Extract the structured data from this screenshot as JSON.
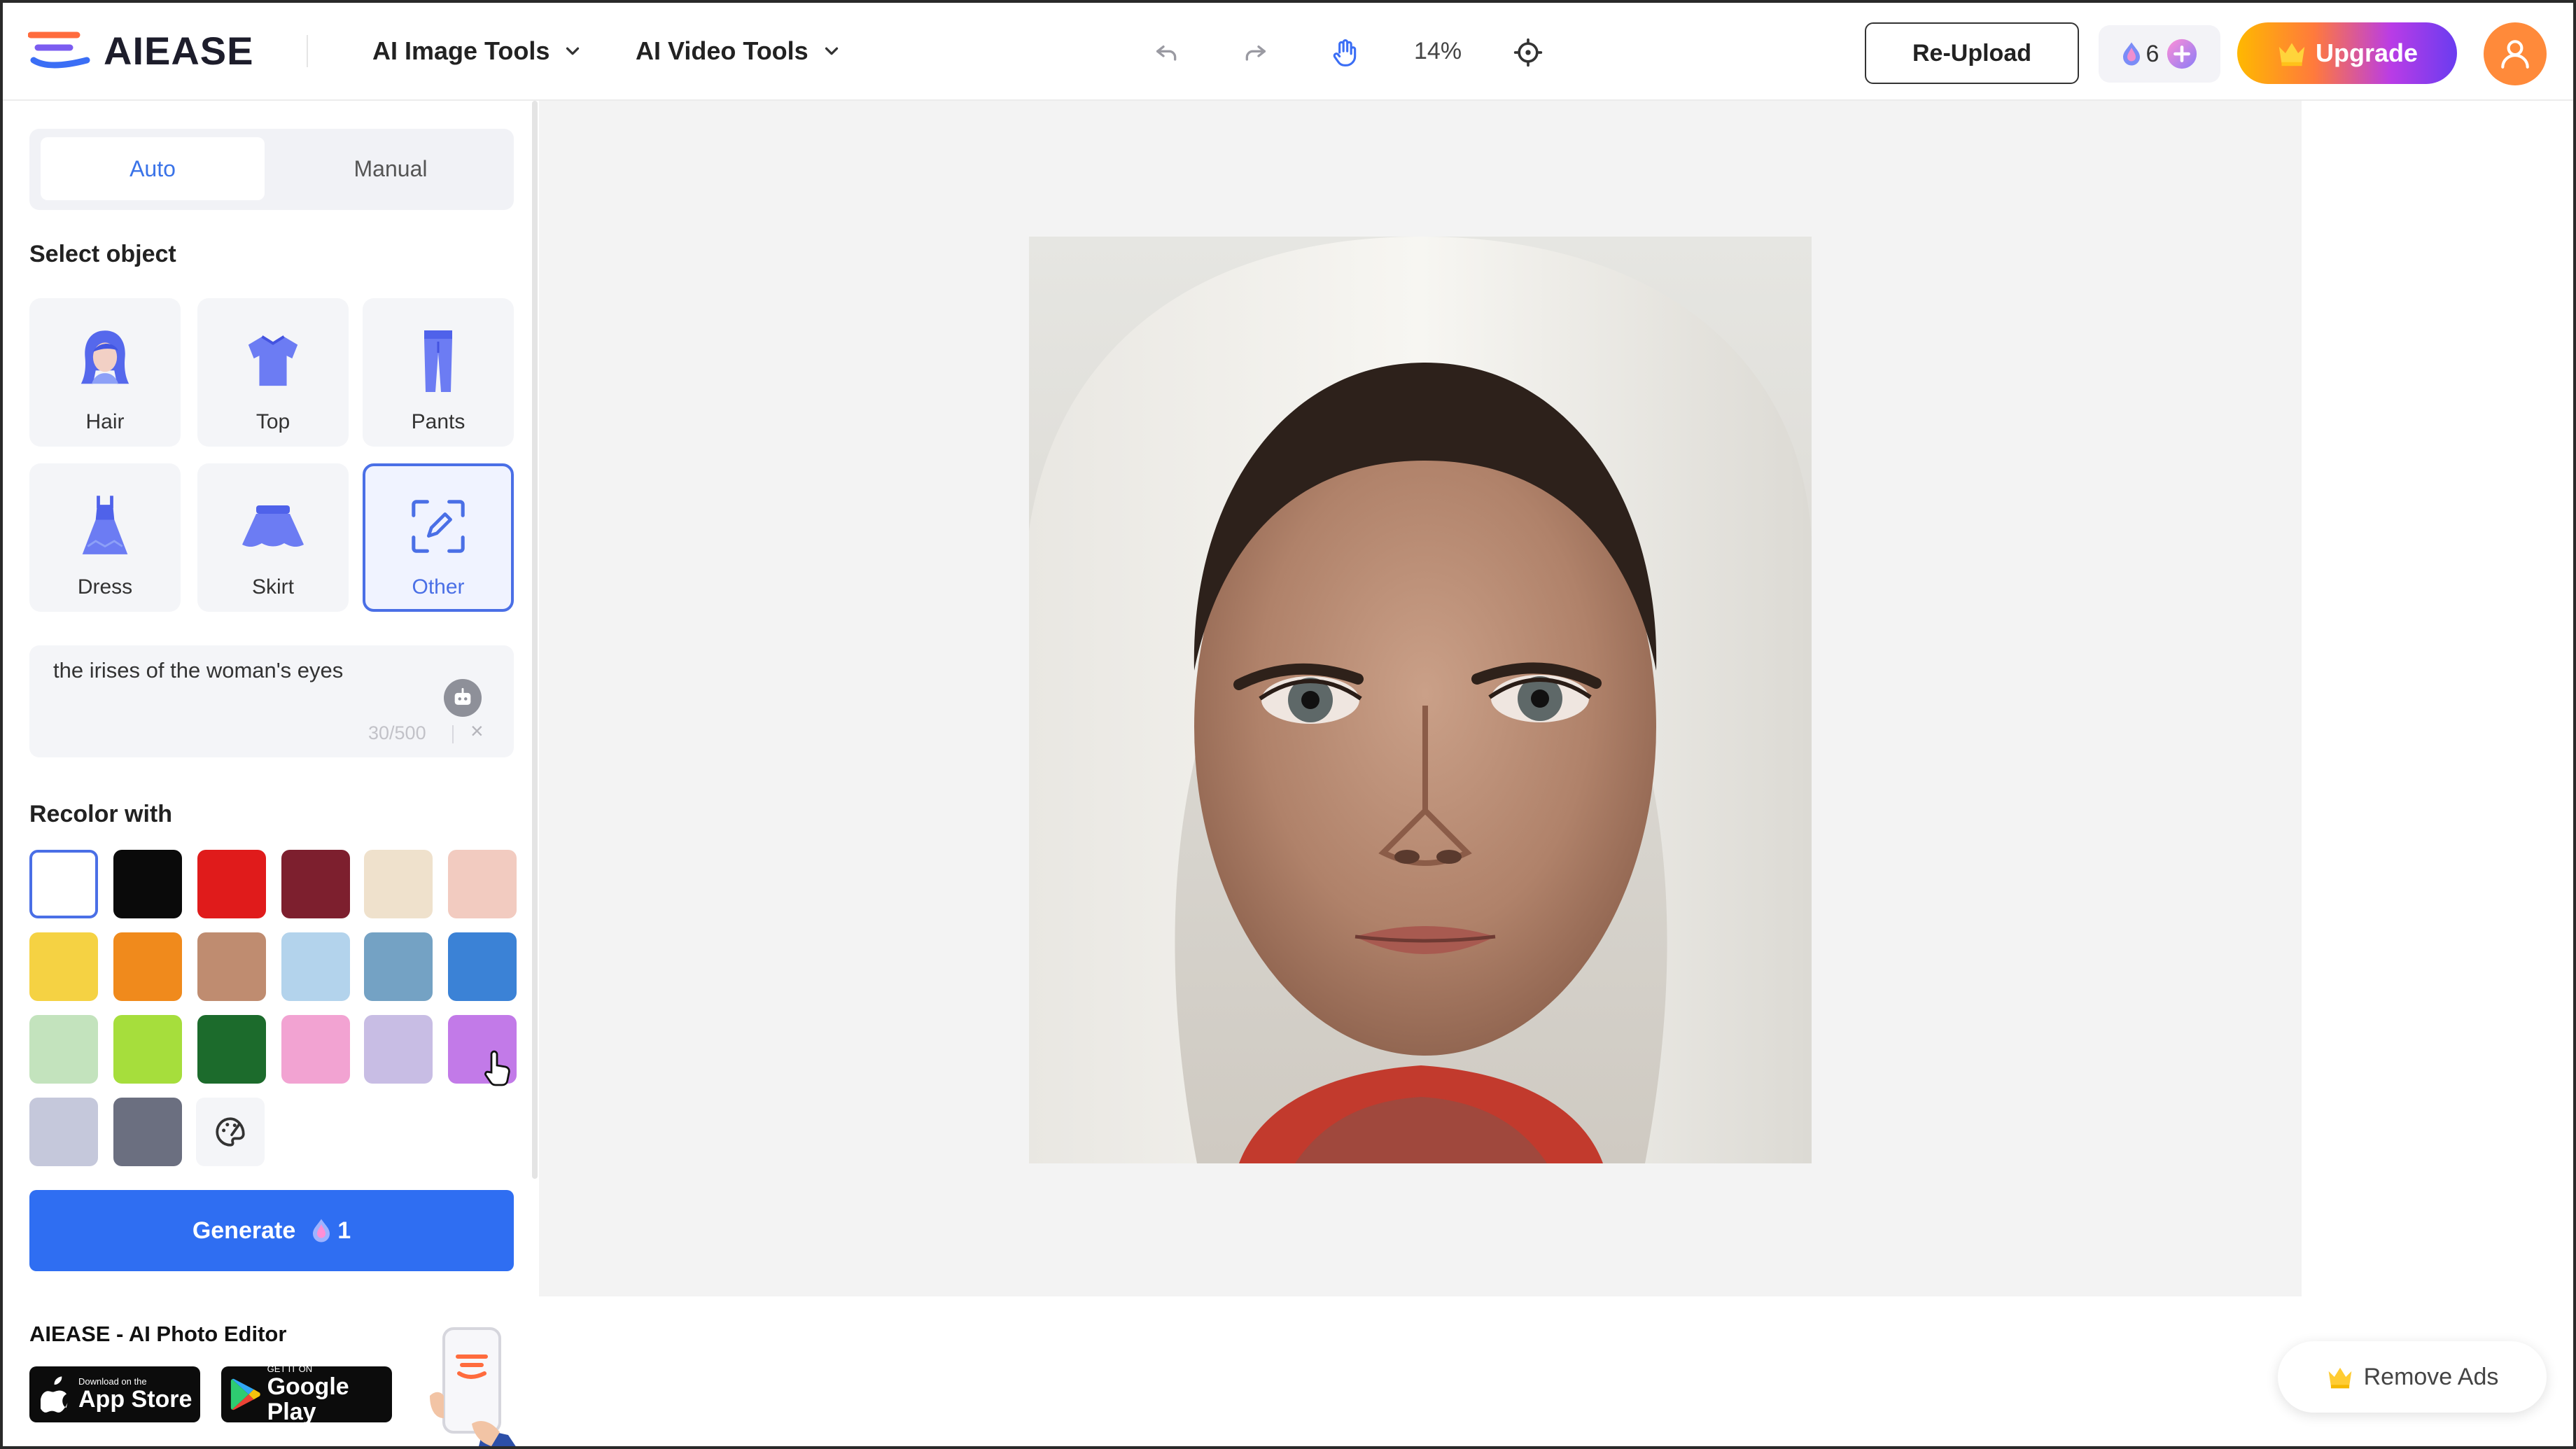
{
  "brand": {
    "name": "AIEASE"
  },
  "header": {
    "nav": [
      {
        "label": "AI Image Tools"
      },
      {
        "label": "AI Video Tools"
      }
    ],
    "zoom": "14%",
    "reupload_label": "Re-Upload",
    "credits": "6",
    "upgrade_label": "Upgrade"
  },
  "sidebar": {
    "tabs": {
      "auto": "Auto",
      "manual": "Manual"
    },
    "select_object_title": "Select object",
    "objects": [
      {
        "label": "Hair",
        "icon": "hair-icon"
      },
      {
        "label": "Top",
        "icon": "top-icon"
      },
      {
        "label": "Pants",
        "icon": "pants-icon"
      },
      {
        "label": "Dress",
        "icon": "dress-icon"
      },
      {
        "label": "Skirt",
        "icon": "skirt-icon"
      },
      {
        "label": "Other",
        "icon": "edit-frame-icon",
        "selected": true
      }
    ],
    "prompt": {
      "value": "the irises of the woman's eyes",
      "count": "30/500",
      "clear": "×"
    },
    "recolor_title": "Recolor with",
    "swatches": [
      "#ffffff",
      "#0a0a0a",
      "#e01b1b",
      "#7d1f2e",
      "#efe1cc",
      "#f2cbc0",
      "#f5d243",
      "#f08a1c",
      "#bf8c70",
      "#b3d3ec",
      "#74a2c4",
      "#3b82d6",
      "#c3e3bd",
      "#a6de3c",
      "#1c6b2c",
      "#f2a3d2",
      "#c8bde4",
      "#c27ae8",
      "#c5c8db",
      "#6b6f80"
    ],
    "selected_swatch": 0,
    "generate_label": "Generate",
    "generate_cost": "1",
    "promo_title": "AIEASE - AI Photo Editor",
    "app_store": {
      "small": "Download on the",
      "big": "App Store"
    },
    "google_play": {
      "small": "GET IT ON",
      "big": "Google Play"
    }
  },
  "canvas": {
    "remove_ads_label": "Remove Ads"
  },
  "colors": {
    "accent": "#2f6ef2",
    "selected_border": "#4a6fe6",
    "brand_orange": "#ff8a3a"
  }
}
